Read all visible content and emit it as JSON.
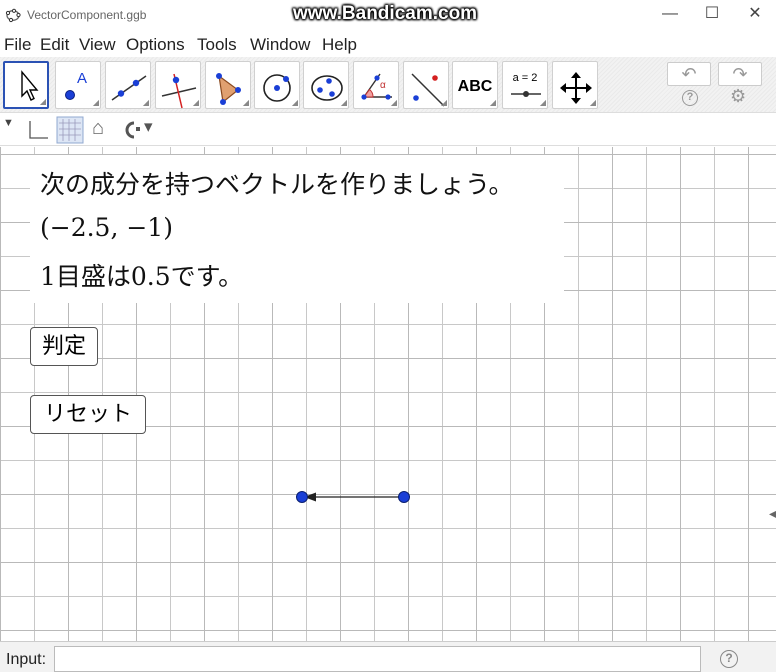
{
  "window": {
    "title": "VectorComponent.ggb",
    "watermark": "www.Bandicam.com",
    "minimize": "—",
    "maximize": "☐",
    "close": "✕"
  },
  "menu": [
    "File",
    "Edit",
    "View",
    "Options",
    "Tools",
    "Window",
    "Help"
  ],
  "toolbar": {
    "text_tool_label": "ABC",
    "slider_tool_label": "a = 2",
    "point_label": "A",
    "angle_label": "α",
    "undo": "↶",
    "redo": "↷",
    "help": "?",
    "settings": "⚙"
  },
  "stylebar": {
    "toggle": "▼",
    "home": "⌂",
    "dropdown": "▾"
  },
  "graphics": {
    "problem_line1": "次の成分を持つベクトルを作りましょう。",
    "problem_line2": "(−2.5, −1)",
    "problem_line3": "1目盛は0.5です。",
    "check_button": "判定",
    "reset_button": "リセット",
    "side_handle": "◀"
  },
  "input": {
    "label": "Input:",
    "value": "",
    "help": "?"
  },
  "colors": {
    "point": "#1a3fd6",
    "selected_tool_border": "#2b52b4"
  }
}
